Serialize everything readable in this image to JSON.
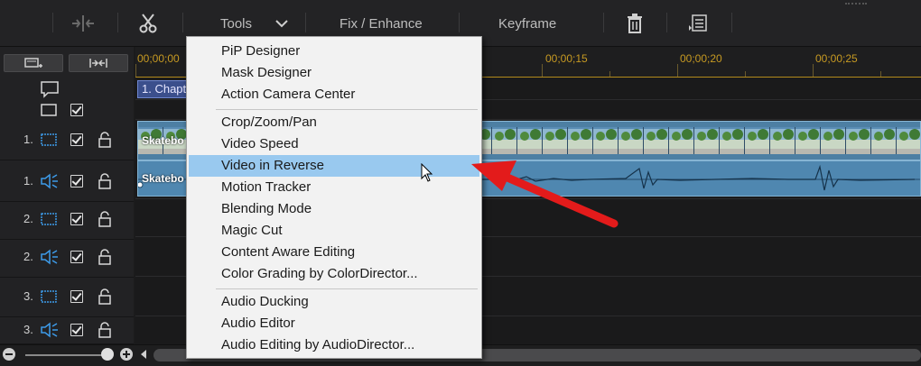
{
  "toolbar": {
    "tools_label": "Tools",
    "fix_label": "Fix / Enhance",
    "keyframe_label": "Keyframe"
  },
  "ruler": {
    "labels": [
      "00;00;00",
      "00;00;15",
      "00;00;20",
      "00;00;25"
    ]
  },
  "timeline": {
    "chapter_label": "1. Chapt",
    "video_clip_label": "Skatebo",
    "audio_clip_label": "Skatebo"
  },
  "tracks": [
    {
      "num": "1.",
      "kind": "video"
    },
    {
      "num": "1.",
      "kind": "audio"
    },
    {
      "num": "2.",
      "kind": "video"
    },
    {
      "num": "2.",
      "kind": "audio"
    },
    {
      "num": "3.",
      "kind": "video"
    },
    {
      "num": "3.",
      "kind": "audio"
    }
  ],
  "menu": {
    "group1": [
      "PiP Designer",
      "Mask Designer",
      "Action Camera Center"
    ],
    "group2": [
      "Crop/Zoom/Pan",
      "Video Speed",
      "Video in Reverse",
      "Motion Tracker",
      "Blending Mode",
      "Magic Cut",
      "Content Aware Editing",
      "Color Grading by ColorDirector..."
    ],
    "group3": [
      "Audio Ducking",
      "Audio Editor",
      "Audio Editing by AudioDirector..."
    ],
    "highlighted": "Video in Reverse"
  },
  "colors": {
    "highlight": "#99c9ef",
    "arrow": "#e31b1b",
    "ruler_text": "#c79a22",
    "icon_blue": "#3d9be9"
  }
}
